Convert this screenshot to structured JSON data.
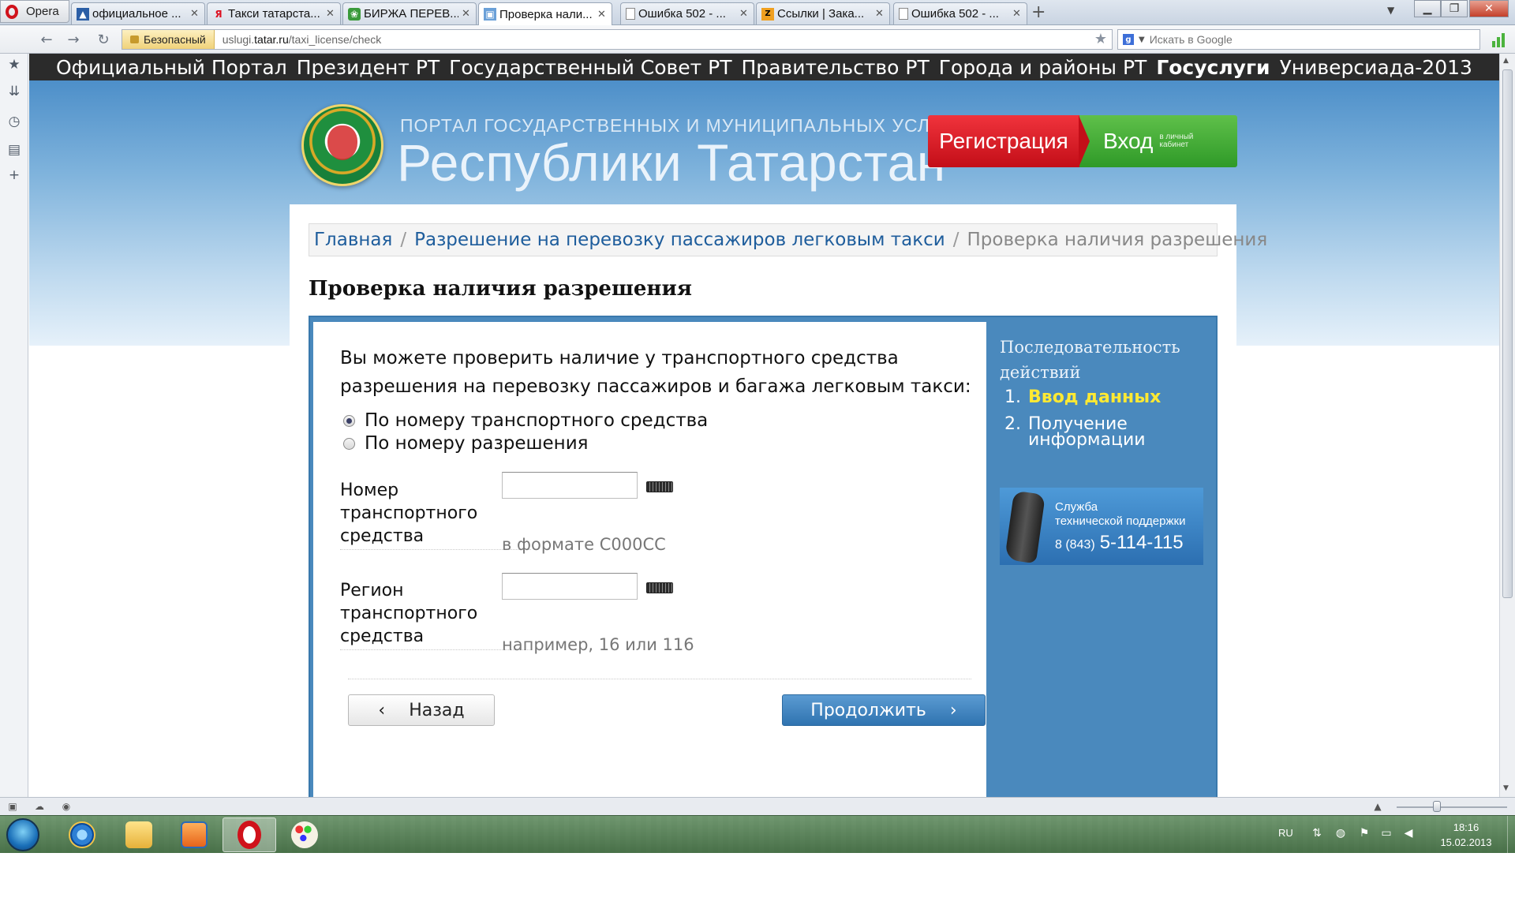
{
  "browser": {
    "menu_label": "Opera",
    "tabs": [
      {
        "label": "официальное ...",
        "icon": "gov-tatar-icon"
      },
      {
        "label": "Такси татарста...",
        "icon": "yandex-icon"
      },
      {
        "label": "БИРЖА ПЕРЕВ...",
        "icon": "exchange-icon"
      },
      {
        "label": "Проверка нали...",
        "icon": "gov-tatar-icon",
        "active": true
      },
      {
        "label": "Ошибка 502 - ...",
        "icon": "page-icon"
      },
      {
        "label": "Ссылки | Зака...",
        "icon": "site-icon"
      },
      {
        "label": "Ошибка 502 - ...",
        "icon": "page-icon"
      }
    ],
    "security_label": "Безопасный",
    "url_prefix": "uslugi.",
    "url_domain": "tatar.ru",
    "url_path": "/taxi_license/check",
    "search_placeholder": "Искать в Google"
  },
  "portal_nav": [
    {
      "label": "Официальный Портал"
    },
    {
      "label": "Президент РТ"
    },
    {
      "label": "Государственный Совет РТ"
    },
    {
      "label": "Правительство РТ"
    },
    {
      "label": "Города и районы РТ"
    },
    {
      "label": "Госуслуги",
      "active": true
    },
    {
      "label": "Универсиада-2013"
    }
  ],
  "header": {
    "subtitle": "ПОРТАЛ ГОСУДАРСТВЕННЫХ И МУНИЦИПАЛЬНЫХ УСЛУГ",
    "title": "Республики Татарстан",
    "register_label": "Регистрация",
    "login_label": "Вход",
    "login_sub": "в личный кабинет"
  },
  "breadcrumb": {
    "home": "Главная",
    "section": "Разрешение на перевозку пассажиров легковым такси",
    "separator": "/",
    "current": "Проверка наличия разрешения"
  },
  "page_title": "Проверка наличия разрешения",
  "form": {
    "intro": "Вы можете проверить наличие у транспортного средства разрешения на перевозку пассажиров и багажа легковым такси:",
    "options": [
      {
        "label": "По номеру транспортного средства",
        "checked": true
      },
      {
        "label": "По номеру разрешения",
        "checked": false
      }
    ],
    "vehicle_number": {
      "label": "Номер транспортного средства",
      "value": "",
      "hint": "в формате С000СС"
    },
    "vehicle_region": {
      "label": "Регион транспортного средства",
      "value": "",
      "hint": "например, 16 или 116"
    },
    "back_label": "Назад",
    "next_label": "Продолжить"
  },
  "steps": {
    "title": "Последовательность действий",
    "items": [
      {
        "num": "1.",
        "label": "Ввод данных",
        "current": true
      },
      {
        "num": "2.",
        "label": "Получение информации",
        "current": false
      }
    ]
  },
  "support": {
    "line1": "Служба",
    "line2": "технической поддержки",
    "phone_code": "8 (843)",
    "phone_number": "5-114-115"
  },
  "taskbar": {
    "lang": "RU",
    "time": "18:16",
    "date": "15.02.2013"
  },
  "colors": {
    "accent_blue": "#1e5d9c",
    "frame_blue": "#4a89bd",
    "register_red": "#e0202a",
    "login_green": "#3fa933",
    "current_step_yellow": "#ffe933"
  }
}
